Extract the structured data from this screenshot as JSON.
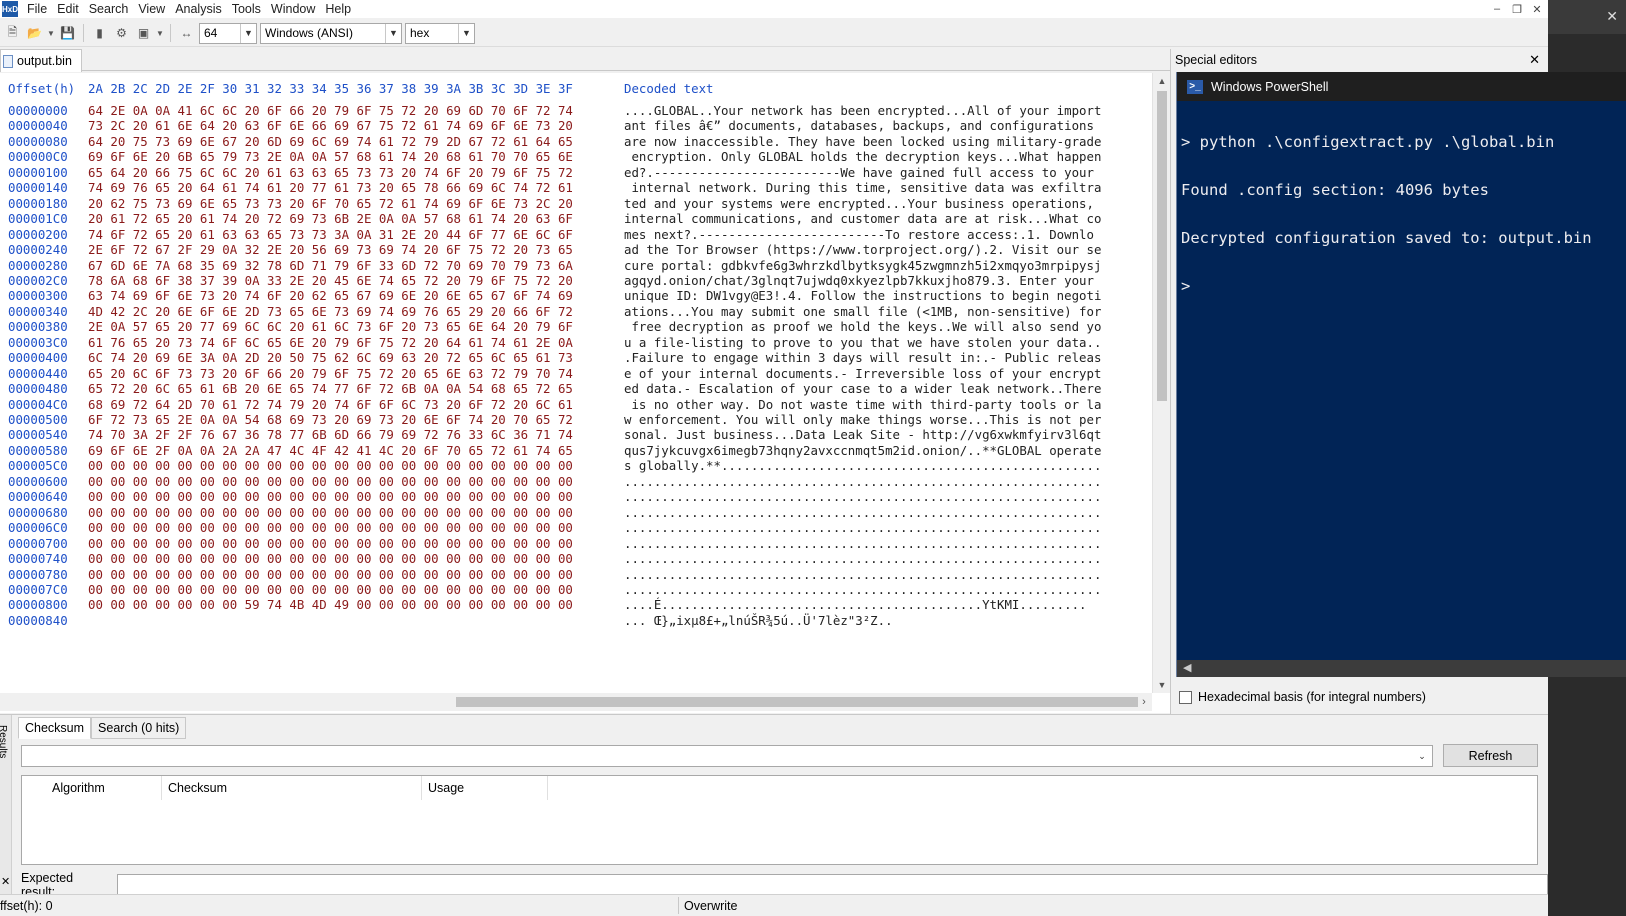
{
  "menu": [
    "File",
    "Edit",
    "Search",
    "View",
    "Analysis",
    "Tools",
    "Window",
    "Help"
  ],
  "toolbar": {
    "bytes_per_row": "64",
    "charset": "Windows (ANSI)",
    "offset_base": "hex"
  },
  "document": {
    "tab_label": "output.bin"
  },
  "hex": {
    "header_offset": "Offset(h)",
    "header_columns": "2A 2B 2C 2D 2E 2F 30 31 32 33 34 35 36 37 38 39 3A 3B 3C 3D 3E 3F",
    "header_text": "Decoded text",
    "rows": [
      {
        "off": "00000000",
        "bytes": "64 2E 0A 0A 41 6C 6C 20 6F 66 20 79 6F 75 72 20 69 6D 70 6F 72 74",
        "txt": "....GLOBAL..Your network has been encrypted...All of your import"
      },
      {
        "off": "00000040",
        "bytes": "73 2C 20 61 6E 64 20 63 6F 6E 66 69 67 75 72 61 74 69 6F 6E 73 20",
        "txt": "ant files â€” documents, databases, backups, and configurations"
      },
      {
        "off": "00000080",
        "bytes": "64 20 75 73 69 6E 67 20 6D 69 6C 69 74 61 72 79 2D 67 72 61 64 65",
        "txt": "are now inaccessible. They have been locked using military-grade"
      },
      {
        "off": "000000C0",
        "bytes": "69 6F 6E 20 6B 65 79 73 2E 0A 0A 57 68 61 74 20 68 61 70 70 65 6E",
        "txt": " encryption. Only GLOBAL holds the decryption keys...What happen"
      },
      {
        "off": "00000100",
        "bytes": "65 64 20 66 75 6C 6C 20 61 63 63 65 73 73 20 74 6F 20 79 6F 75 72",
        "txt": "ed?.-------------------------We have gained full access to your"
      },
      {
        "off": "00000140",
        "bytes": "74 69 76 65 20 64 61 74 61 20 77 61 73 20 65 78 66 69 6C 74 72 61",
        "txt": " internal network. During this time, sensitive data was exfiltra"
      },
      {
        "off": "00000180",
        "bytes": "20 62 75 73 69 6E 65 73 73 20 6F 70 65 72 61 74 69 6F 6E 73 2C 20",
        "txt": "ted and your systems were encrypted...Your business operations,"
      },
      {
        "off": "000001C0",
        "bytes": "20 61 72 65 20 61 74 20 72 69 73 6B 2E 0A 0A 57 68 61 74 20 63 6F",
        "txt": "internal communications, and customer data are at risk...What co"
      },
      {
        "off": "00000200",
        "bytes": "74 6F 72 65 20 61 63 63 65 73 73 3A 0A 31 2E 20 44 6F 77 6E 6C 6F",
        "txt": "mes next?.-------------------------To restore access:.1. Downlo"
      },
      {
        "off": "00000240",
        "bytes": "2E 6F 72 67 2F 29 0A 32 2E 20 56 69 73 69 74 20 6F 75 72 20 73 65",
        "txt": "ad the Tor Browser (https://www.torproject.org/).2. Visit our se"
      },
      {
        "off": "00000280",
        "bytes": "67 6D 6E 7A 68 35 69 32 78 6D 71 79 6F 33 6D 72 70 69 70 79 73 6A",
        "txt": "cure portal: gdbkvfe6g3whrzkdlbytksygk45zwgmnzh5i2xmqyo3mrpipysj"
      },
      {
        "off": "000002C0",
        "bytes": "78 6A 68 6F 38 37 39 0A 33 2E 20 45 6E 74 65 72 20 79 6F 75 72 20",
        "txt": "agqyd.onion/chat/3glnqt7ujwdq0xkyezlpb7kkuxjho879.3. Enter your"
      },
      {
        "off": "00000300",
        "bytes": "63 74 69 6F 6E 73 20 74 6F 20 62 65 67 69 6E 20 6E 65 67 6F 74 69",
        "txt": "unique ID: DW1vgy@E3!.4. Follow the instructions to begin negoti"
      },
      {
        "off": "00000340",
        "bytes": "4D 42 2C 20 6E 6F 6E 2D 73 65 6E 73 69 74 69 76 65 29 20 66 6F 72",
        "txt": "ations...You may submit one small file (<1MB, non-sensitive) for"
      },
      {
        "off": "00000380",
        "bytes": "2E 0A 57 65 20 77 69 6C 6C 20 61 6C 73 6F 20 73 65 6E 64 20 79 6F",
        "txt": " free decryption as proof we hold the keys..We will also send yo"
      },
      {
        "off": "000003C0",
        "bytes": "61 76 65 20 73 74 6F 6C 65 6E 20 79 6F 75 72 20 64 61 74 61 2E 0A",
        "txt": "u a file-listing to prove to you that we have stolen your data.."
      },
      {
        "off": "00000400",
        "bytes": "6C 74 20 69 6E 3A 0A 2D 20 50 75 62 6C 69 63 20 72 65 6C 65 61 73",
        "txt": ".Failure to engage within 3 days will result in:.- Public releas"
      },
      {
        "off": "00000440",
        "bytes": "65 20 6C 6F 73 73 20 6F 66 20 79 6F 75 72 20 65 6E 63 72 79 70 74",
        "txt": "e of your internal documents.- Irreversible loss of your encrypt"
      },
      {
        "off": "00000480",
        "bytes": "65 72 20 6C 65 61 6B 20 6E 65 74 77 6F 72 6B 0A 0A 54 68 65 72 65",
        "txt": "ed data.- Escalation of your case to a wider leak network..There"
      },
      {
        "off": "000004C0",
        "bytes": "68 69 72 64 2D 70 61 72 74 79 20 74 6F 6F 6C 73 20 6F 72 20 6C 61",
        "txt": " is no other way. Do not waste time with third-party tools or la"
      },
      {
        "off": "00000500",
        "bytes": "6F 72 73 65 2E 0A 0A 54 68 69 73 20 69 73 20 6E 6F 74 20 70 65 72",
        "txt": "w enforcement. You will only make things worse...This is not per"
      },
      {
        "off": "00000540",
        "bytes": "74 70 3A 2F 2F 76 67 36 78 77 6B 6D 66 79 69 72 76 33 6C 36 71 74",
        "txt": "sonal. Just business...Data Leak Site - http://vg6xwkmfyirv3l6qt"
      },
      {
        "off": "00000580",
        "bytes": "69 6F 6E 2F 0A 0A 2A 2A 47 4C 4F 42 41 4C 20 6F 70 65 72 61 74 65",
        "txt": "qus7jykcuvgx6imegb73hqny2avxccnmqt5m2id.onion/..**GLOBAL operate"
      },
      {
        "off": "000005C0",
        "bytes": "00 00 00 00 00 00 00 00 00 00 00 00 00 00 00 00 00 00 00 00 00 00",
        "txt": "s globally.**..................................................."
      },
      {
        "off": "00000600",
        "bytes": "00 00 00 00 00 00 00 00 00 00 00 00 00 00 00 00 00 00 00 00 00 00",
        "txt": "................................................................"
      },
      {
        "off": "00000640",
        "bytes": "00 00 00 00 00 00 00 00 00 00 00 00 00 00 00 00 00 00 00 00 00 00",
        "txt": "................................................................"
      },
      {
        "off": "00000680",
        "bytes": "00 00 00 00 00 00 00 00 00 00 00 00 00 00 00 00 00 00 00 00 00 00",
        "txt": "................................................................"
      },
      {
        "off": "000006C0",
        "bytes": "00 00 00 00 00 00 00 00 00 00 00 00 00 00 00 00 00 00 00 00 00 00",
        "txt": "................................................................"
      },
      {
        "off": "00000700",
        "bytes": "00 00 00 00 00 00 00 00 00 00 00 00 00 00 00 00 00 00 00 00 00 00",
        "txt": "................................................................"
      },
      {
        "off": "00000740",
        "bytes": "00 00 00 00 00 00 00 00 00 00 00 00 00 00 00 00 00 00 00 00 00 00",
        "txt": "................................................................"
      },
      {
        "off": "00000780",
        "bytes": "00 00 00 00 00 00 00 00 00 00 00 00 00 00 00 00 00 00 00 00 00 00",
        "txt": "................................................................"
      },
      {
        "off": "000007C0",
        "bytes": "00 00 00 00 00 00 00 00 00 00 00 00 00 00 00 00 00 00 00 00 00 00",
        "txt": "................................................................"
      },
      {
        "off": "00000800",
        "bytes": "00 00 00 00 00 00 00 59 74 4B 4D 49 00 00 00 00 00 00 00 00 00 00",
        "txt": "....É...........................................YtKMI........."
      },
      {
        "off": "00000840",
        "bytes": "",
        "txt": "... Œ}„ixµ8£+„lnúŠR¾5ú..Ü'7lèz\"3²Z.."
      }
    ]
  },
  "special_editors": {
    "title": "Special editors",
    "hex_basis_label": "Hexadecimal basis (for integral numbers)"
  },
  "powershell": {
    "title": "Windows PowerShell",
    "lines": [
      "> python .\\configextract.py .\\global.bin",
      "Found .config section: 4096 bytes",
      "Decrypted configuration saved to: output.bin",
      ">"
    ]
  },
  "results": {
    "side_label": "Results",
    "tabs": [
      "Checksum",
      "Search (0 hits)"
    ],
    "refresh_label": "Refresh",
    "columns": [
      "Algorithm",
      "Checksum",
      "Usage"
    ],
    "expected_label": "Expected result:"
  },
  "status": {
    "offset": "ffset(h): 0",
    "mode": "Overwrite"
  }
}
